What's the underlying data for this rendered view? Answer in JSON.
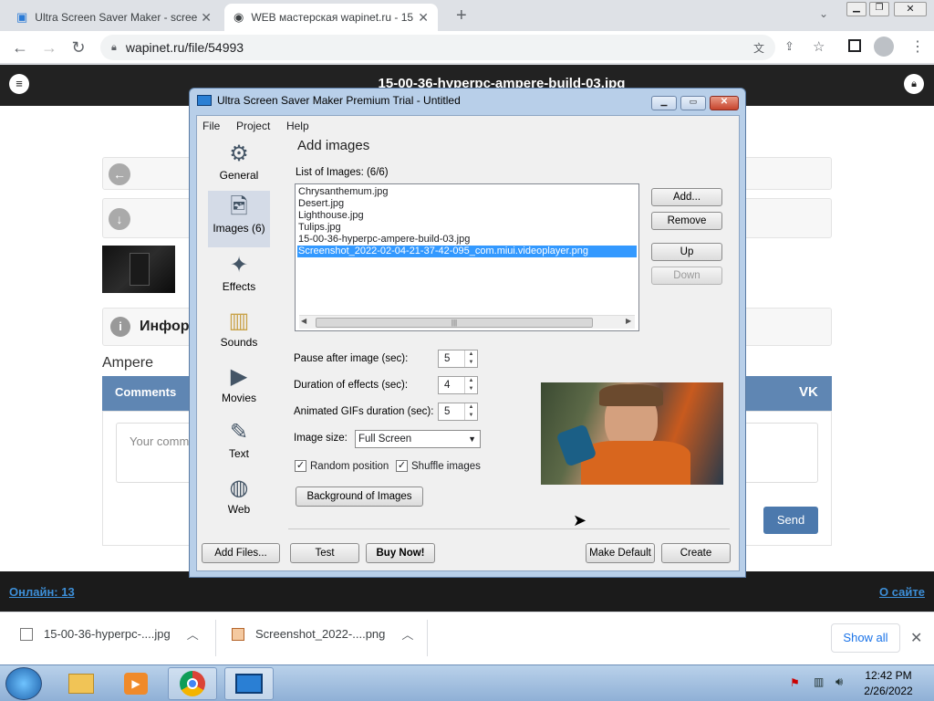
{
  "browser": {
    "tabs": [
      {
        "title": "Ultra Screen Saver Maker - scree",
        "active": false
      },
      {
        "title": "WEB мастерская wapinet.ru - 15",
        "active": true
      }
    ],
    "address": "wapinet.ru/file/54993"
  },
  "page": {
    "site_title": "15-00-36-hyperpc-ampere-build-03.jpg",
    "info_label": "Инфор",
    "file_title": "Ampere",
    "comments_label": "Comments",
    "comment_placeholder": "Your comm",
    "send_label": "Send",
    "online_label": "Онлайн: 13",
    "about_label": "О сайте"
  },
  "downloads": {
    "items": [
      {
        "name": "15-00-36-hyperpc-....jpg"
      },
      {
        "name": "Screenshot_2022-....png"
      }
    ],
    "show_all": "Show all"
  },
  "taskbar": {
    "time": "12:42 PM",
    "date": "2/26/2022"
  },
  "dialog": {
    "title": "Ultra Screen Saver Maker Premium Trial - Untitled",
    "menu": [
      "File",
      "Project",
      "Help"
    ],
    "sidebar": [
      {
        "label": "General",
        "icon": "gear-icon"
      },
      {
        "label": "Images (6)",
        "icon": "images-icon"
      },
      {
        "label": "Effects",
        "icon": "effects-icon"
      },
      {
        "label": "Sounds",
        "icon": "sounds-icon"
      },
      {
        "label": "Movies",
        "icon": "movie-icon"
      },
      {
        "label": "Text",
        "icon": "pen-icon"
      },
      {
        "label": "Web",
        "icon": "globe-icon"
      }
    ],
    "heading": "Add images",
    "list_label": "List of Images:  (6/6)",
    "images": [
      "Chrysanthemum.jpg",
      "Desert.jpg",
      "Lighthouse.jpg",
      "Tulips.jpg",
      "15-00-36-hyperpc-ampere-build-03.jpg",
      "Screenshot_2022-02-04-21-37-42-095_com.miui.videoplayer.png"
    ],
    "selected_index": 5,
    "buttons": {
      "add": "Add...",
      "remove": "Remove",
      "up": "Up",
      "down": "Down",
      "background": "Background of Images",
      "add_files": "Add Files...",
      "test": "Test",
      "buy": "Buy Now!",
      "make_default": "Make Default",
      "create": "Create"
    },
    "settings": {
      "pause_label": "Pause after image (sec):",
      "pause_value": "5",
      "effects_label": "Duration of effects (sec):",
      "effects_value": "4",
      "gif_label": "Animated GIFs duration (sec):",
      "gif_value": "5",
      "size_label": "Image size:",
      "size_value": "Full Screen",
      "random_label": "Random position",
      "random_checked": true,
      "shuffle_label": "Shuffle images",
      "shuffle_checked": true
    }
  }
}
